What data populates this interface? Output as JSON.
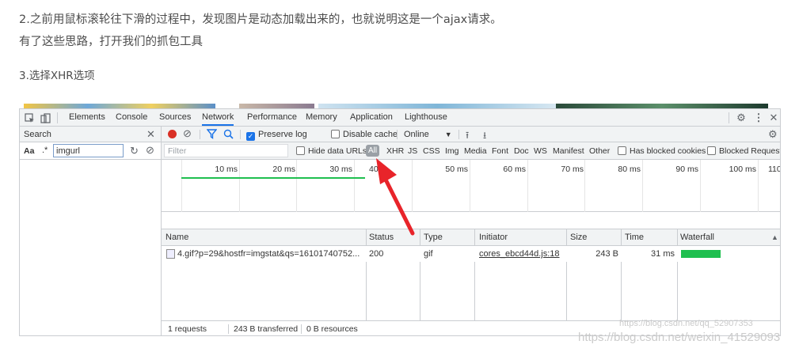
{
  "article": {
    "line1": "2.之前用鼠标滚轮往下滑的过程中，发现图片是动态加载出来的，也就说明这是一个ajax请求。",
    "line2": "有了这些思路，打开我们的抓包工具",
    "line3": "3.选择XHR选项"
  },
  "devtools": {
    "tabs": [
      "Elements",
      "Console",
      "Sources",
      "Network",
      "Performance",
      "Memory",
      "Application",
      "Lighthouse"
    ],
    "active_tab": "Network",
    "search_pane": {
      "title": "Search",
      "case_label": "Aa",
      "regex_label": ".*",
      "query": "imgurl"
    },
    "toolbar": {
      "preserve_log": "Preserve log",
      "disable_cache": "Disable cache",
      "throttle": "Online"
    },
    "filter": {
      "placeholder": "Filter",
      "hide_data_urls": "Hide data URLs",
      "types": [
        "All",
        "XHR",
        "JS",
        "CSS",
        "Img",
        "Media",
        "Font",
        "Doc",
        "WS",
        "Manifest",
        "Other"
      ],
      "has_blocked_cookies": "Has blocked cookies",
      "blocked_requests": "Blocked Requests"
    },
    "overview_ticks": [
      "10 ms",
      "20 ms",
      "30 ms",
      "40",
      "50 ms",
      "60 ms",
      "70 ms",
      "80 ms",
      "90 ms",
      "100 ms",
      "110"
    ],
    "columns": [
      "Name",
      "Status",
      "Type",
      "Initiator",
      "Size",
      "Time",
      "Waterfall"
    ],
    "rows": [
      {
        "name": "4.gif?p=29&hostfr=imgstat&qs=16101740752...",
        "status": "200",
        "type": "gif",
        "initiator": "cores_ebcd44d.js:18",
        "size": "243 B",
        "time": "31 ms"
      }
    ],
    "status_bar": {
      "requests": "1 requests",
      "transferred": "243 B transferred",
      "resources": "0 B resources"
    }
  },
  "watermarks": {
    "inner": "https://blog.csdn.net/qq_52907353",
    "outer": "https://blog.csdn.net/weixin_41529093"
  },
  "colors": {
    "accent": "#1a73e8",
    "record": "#d93025",
    "arrow": "#e8242a",
    "waterfall_bar": "#1fbf4f"
  }
}
